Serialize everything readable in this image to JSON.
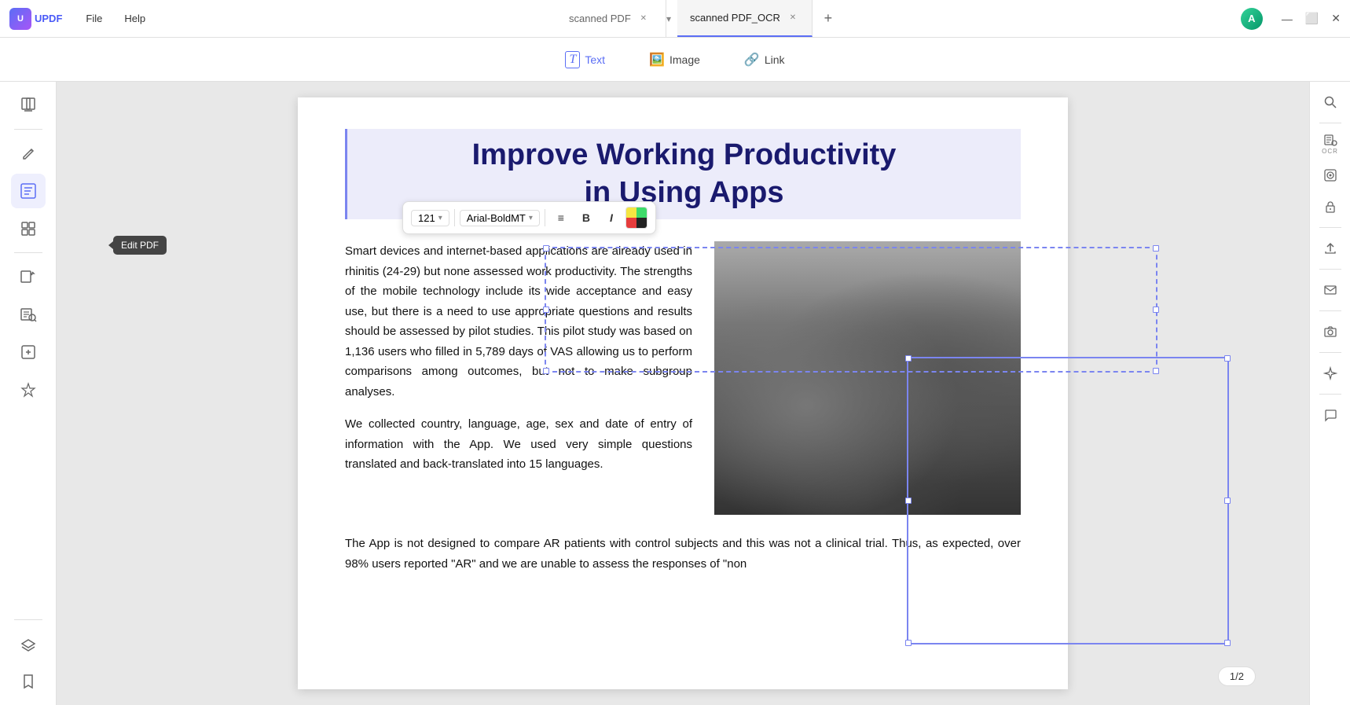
{
  "app": {
    "logo": "UPDF",
    "menu": [
      "File",
      "Help"
    ]
  },
  "tabs": [
    {
      "id": "tab1",
      "label": "scanned PDF",
      "active": false
    },
    {
      "id": "tab2",
      "label": "scanned PDF_OCR",
      "active": true
    }
  ],
  "tab_add": "+",
  "window_controls": [
    "—",
    "⬜",
    "✕"
  ],
  "toolbar": {
    "text_label": "Text",
    "image_label": "Image",
    "link_label": "Link"
  },
  "format_toolbar": {
    "font_size": "121",
    "font_size_arrow": "▾",
    "font_name": "Arial-BoldMT",
    "font_name_arrow": "▾",
    "align_icon": "≡",
    "bold_label": "B",
    "italic_label": "I"
  },
  "left_sidebar": {
    "icons": [
      {
        "id": "reader",
        "symbol": "📖",
        "tooltip": ""
      },
      {
        "id": "edit-pdf",
        "symbol": "✏️",
        "tooltip": "Edit PDF",
        "active": true
      },
      {
        "id": "organize",
        "symbol": "📋",
        "tooltip": ""
      },
      {
        "id": "convert",
        "symbol": "🔄",
        "tooltip": ""
      },
      {
        "id": "ocr",
        "symbol": "⊞",
        "tooltip": ""
      },
      {
        "id": "compress",
        "symbol": "⊟",
        "tooltip": ""
      },
      {
        "id": "ai",
        "symbol": "✦",
        "tooltip": ""
      }
    ],
    "bottom_icons": [
      {
        "id": "layers",
        "symbol": "⧉"
      },
      {
        "id": "bookmark",
        "symbol": "🔖"
      }
    ]
  },
  "right_sidebar": {
    "icons": [
      {
        "id": "search",
        "symbol": "🔍"
      },
      {
        "id": "ocr-label",
        "label": "OCR"
      },
      {
        "id": "scan",
        "symbol": "⊡"
      },
      {
        "id": "lock",
        "symbol": "🔒"
      },
      {
        "id": "share",
        "symbol": "↑"
      },
      {
        "id": "email",
        "symbol": "✉"
      },
      {
        "id": "camera",
        "symbol": "📷"
      },
      {
        "id": "sparkle",
        "symbol": "✦"
      },
      {
        "id": "chat",
        "symbol": "💬"
      }
    ]
  },
  "pdf": {
    "title_line1": "Improve Working Productivity",
    "title_line2": "in Using Apps",
    "paragraph1": "Smart devices and internet-based applications are already used in rhinitis (24-29) but none assessed work productivity. The strengths of the mobile technology include its wide acceptance and easy use, but there is a need to use appropriate questions and results should be assessed by pilot studies. This pilot study was based on 1,136 users who filled in 5,789 days of VAS allowing us to perform comparisons among outcomes, but not to make subgroup analyses.",
    "paragraph2": "We collected country, language, age, sex and date of entry of information with the App. We used very simple questions translated and back-translated into 15 languages.",
    "footer_text": "The App is not designed to compare AR patients with control subjects and this was not a clinical trial. Thus, as expected, over 98% users reported \"AR\" and we are unable to assess the responses of \"non"
  },
  "page_indicator": "1/2",
  "edit_pdf_tooltip": "Edit PDF"
}
